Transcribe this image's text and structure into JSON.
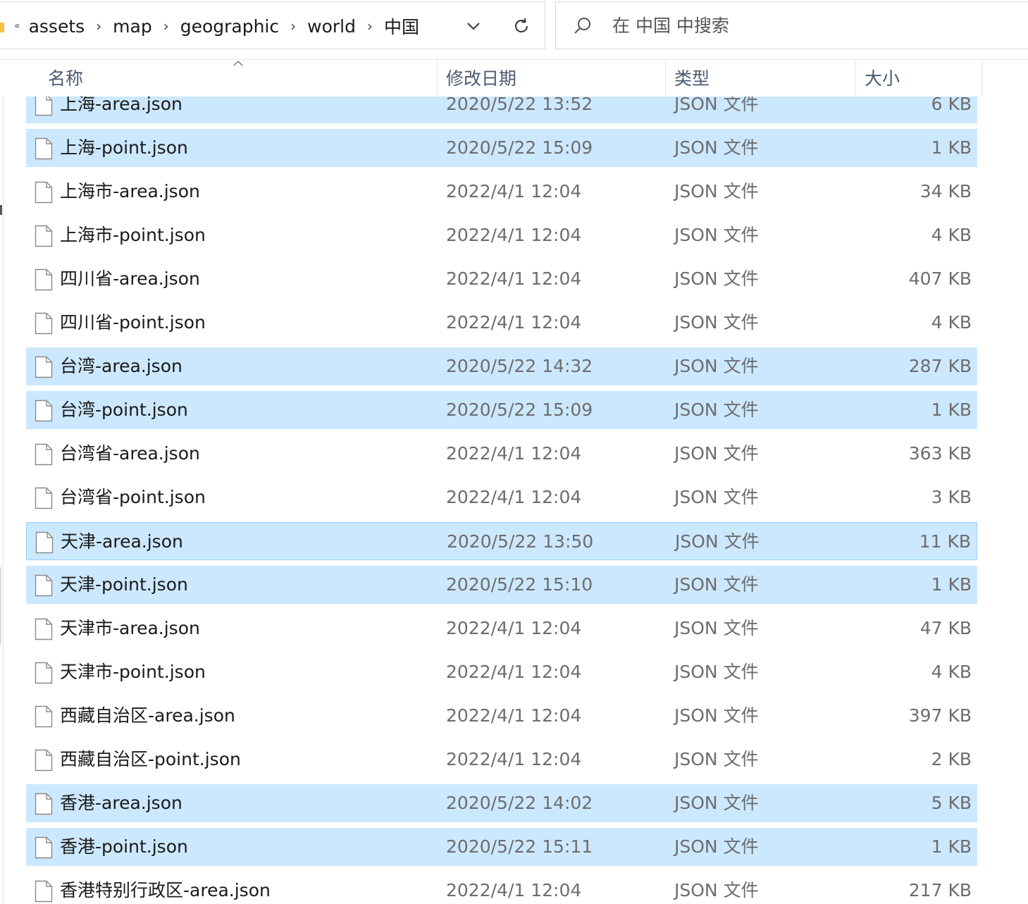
{
  "address": {
    "crumbs": [
      "assets",
      "map",
      "geographic",
      "world",
      "中国"
    ],
    "overflow_glyph": "«"
  },
  "search": {
    "placeholder": "在 中国 中搜索"
  },
  "columns": {
    "name": "名称",
    "date": "修改日期",
    "type": "类型",
    "size": "大小"
  },
  "files": [
    {
      "name": "上海-area.json",
      "date": "2020/5/22 13:52",
      "type": "JSON 文件",
      "size": "6 KB",
      "selected": true
    },
    {
      "name": "上海-point.json",
      "date": "2020/5/22 15:09",
      "type": "JSON 文件",
      "size": "1 KB",
      "selected": true
    },
    {
      "name": "上海市-area.json",
      "date": "2022/4/1 12:04",
      "type": "JSON 文件",
      "size": "34 KB",
      "selected": false
    },
    {
      "name": "上海市-point.json",
      "date": "2022/4/1 12:04",
      "type": "JSON 文件",
      "size": "4 KB",
      "selected": false
    },
    {
      "name": "四川省-area.json",
      "date": "2022/4/1 12:04",
      "type": "JSON 文件",
      "size": "407 KB",
      "selected": false
    },
    {
      "name": "四川省-point.json",
      "date": "2022/4/1 12:04",
      "type": "JSON 文件",
      "size": "4 KB",
      "selected": false
    },
    {
      "name": "台湾-area.json",
      "date": "2020/5/22 14:32",
      "type": "JSON 文件",
      "size": "287 KB",
      "selected": true
    },
    {
      "name": "台湾-point.json",
      "date": "2020/5/22 15:09",
      "type": "JSON 文件",
      "size": "1 KB",
      "selected": true
    },
    {
      "name": "台湾省-area.json",
      "date": "2022/4/1 12:04",
      "type": "JSON 文件",
      "size": "363 KB",
      "selected": false
    },
    {
      "name": "台湾省-point.json",
      "date": "2022/4/1 12:04",
      "type": "JSON 文件",
      "size": "3 KB",
      "selected": false
    },
    {
      "name": "天津-area.json",
      "date": "2020/5/22 13:50",
      "type": "JSON 文件",
      "size": "11 KB",
      "selected": true,
      "focused": true
    },
    {
      "name": "天津-point.json",
      "date": "2020/5/22 15:10",
      "type": "JSON 文件",
      "size": "1 KB",
      "selected": true
    },
    {
      "name": "天津市-area.json",
      "date": "2022/4/1 12:04",
      "type": "JSON 文件",
      "size": "47 KB",
      "selected": false
    },
    {
      "name": "天津市-point.json",
      "date": "2022/4/1 12:04",
      "type": "JSON 文件",
      "size": "4 KB",
      "selected": false
    },
    {
      "name": "西藏自治区-area.json",
      "date": "2022/4/1 12:04",
      "type": "JSON 文件",
      "size": "397 KB",
      "selected": false
    },
    {
      "name": "西藏自治区-point.json",
      "date": "2022/4/1 12:04",
      "type": "JSON 文件",
      "size": "2 KB",
      "selected": false
    },
    {
      "name": "香港-area.json",
      "date": "2020/5/22 14:02",
      "type": "JSON 文件",
      "size": "5 KB",
      "selected": true
    },
    {
      "name": "香港-point.json",
      "date": "2020/5/22 15:11",
      "type": "JSON 文件",
      "size": "1 KB",
      "selected": true
    },
    {
      "name": "香港特别行政区-area.json",
      "date": "2022/4/1 12:04",
      "type": "JSON 文件",
      "size": "217 KB",
      "selected": false
    }
  ],
  "colors": {
    "selection": "#cce8ff",
    "focus_border": "#99d1ff",
    "folder": "#f3c244"
  }
}
